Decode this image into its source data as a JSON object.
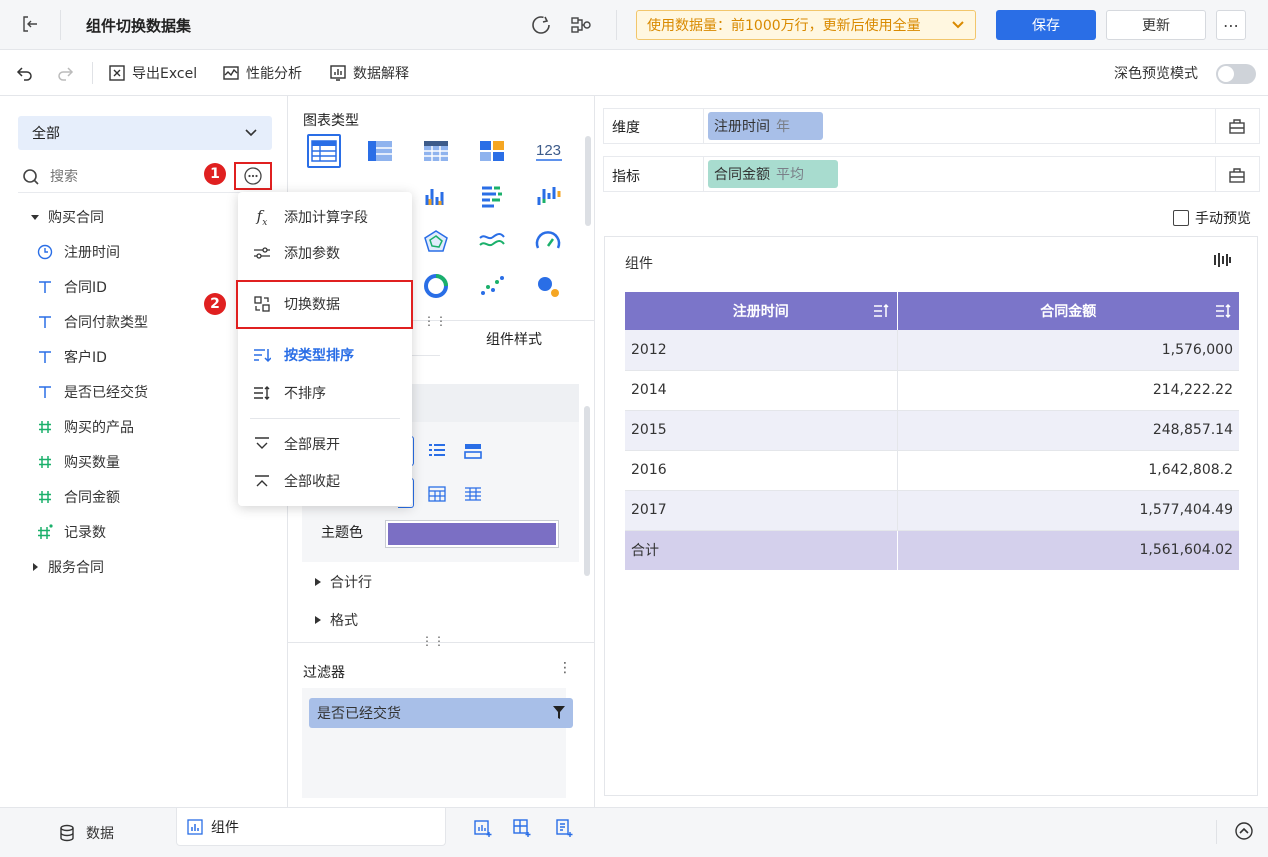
{
  "header": {
    "title": "组件切换数据集",
    "notice": "使用数据量：前1000万行，更新后使用全量",
    "save_label": "保存",
    "update_label": "更新"
  },
  "toolbar": {
    "export_excel": "导出Excel",
    "performance": "性能分析",
    "data_explain": "数据解释",
    "dark_preview": "深色预览模式"
  },
  "left": {
    "dataset_select": "全部",
    "search_placeholder": "搜索",
    "group1": "购买合同",
    "fields": [
      {
        "label": "注册时间",
        "icon": "clock-icon"
      },
      {
        "label": "合同ID",
        "icon": "text-icon"
      },
      {
        "label": "合同付款类型",
        "icon": "text-icon"
      },
      {
        "label": "客户ID",
        "icon": "text-icon"
      },
      {
        "label": "是否已经交货",
        "icon": "text-icon"
      },
      {
        "label": "购买的产品",
        "icon": "hash-icon"
      },
      {
        "label": "购买数量",
        "icon": "hash-icon"
      },
      {
        "label": "合同金额",
        "icon": "hash-icon"
      },
      {
        "label": "记录数",
        "icon": "hash-star-icon"
      }
    ],
    "group2": "服务合同"
  },
  "menu": {
    "items": [
      {
        "label": "添加计算字段",
        "icon": "fx-icon"
      },
      {
        "label": "添加参数",
        "icon": "sliders-icon"
      },
      {
        "label": "切换数据",
        "icon": "switch-data-icon"
      },
      {
        "label": "按类型排序",
        "icon": "sort-type-icon"
      },
      {
        "label": "不排序",
        "icon": "no-sort-icon"
      },
      {
        "label": "全部展开",
        "icon": "expand-all-icon"
      },
      {
        "label": "全部收起",
        "icon": "collapse-all-icon"
      }
    ]
  },
  "annotations": {
    "step1": "1",
    "step2": "2"
  },
  "middle": {
    "chart_type_label": "图表类型",
    "tab_style": "组件样式",
    "theme_color_label": "主题色",
    "theme_color": "#7b6fc4",
    "sum_row": "合计行",
    "format": "格式",
    "filter_label": "过滤器",
    "filter_item": "是否已经交货"
  },
  "right": {
    "dimension_label": "维度",
    "dimension_field": "注册时间",
    "dimension_suffix": "年",
    "measure_label": "指标",
    "measure_field": "合同金额",
    "measure_suffix": "平均",
    "manual_preview": "手动预览",
    "component_title": "组件"
  },
  "table": {
    "headers": [
      "注册时间",
      "合同金额"
    ],
    "rows": [
      [
        "2012",
        "1,576,000"
      ],
      [
        "2014",
        "214,222.22"
      ],
      [
        "2015",
        "248,857.14"
      ],
      [
        "2016",
        "1,642,808.2"
      ],
      [
        "2017",
        "1,577,404.49"
      ]
    ],
    "total": [
      "合计",
      "1,561,604.02"
    ],
    "header_color": "#7b75c9"
  },
  "bottom": {
    "data_tab": "数据",
    "component_tab": "组件"
  }
}
